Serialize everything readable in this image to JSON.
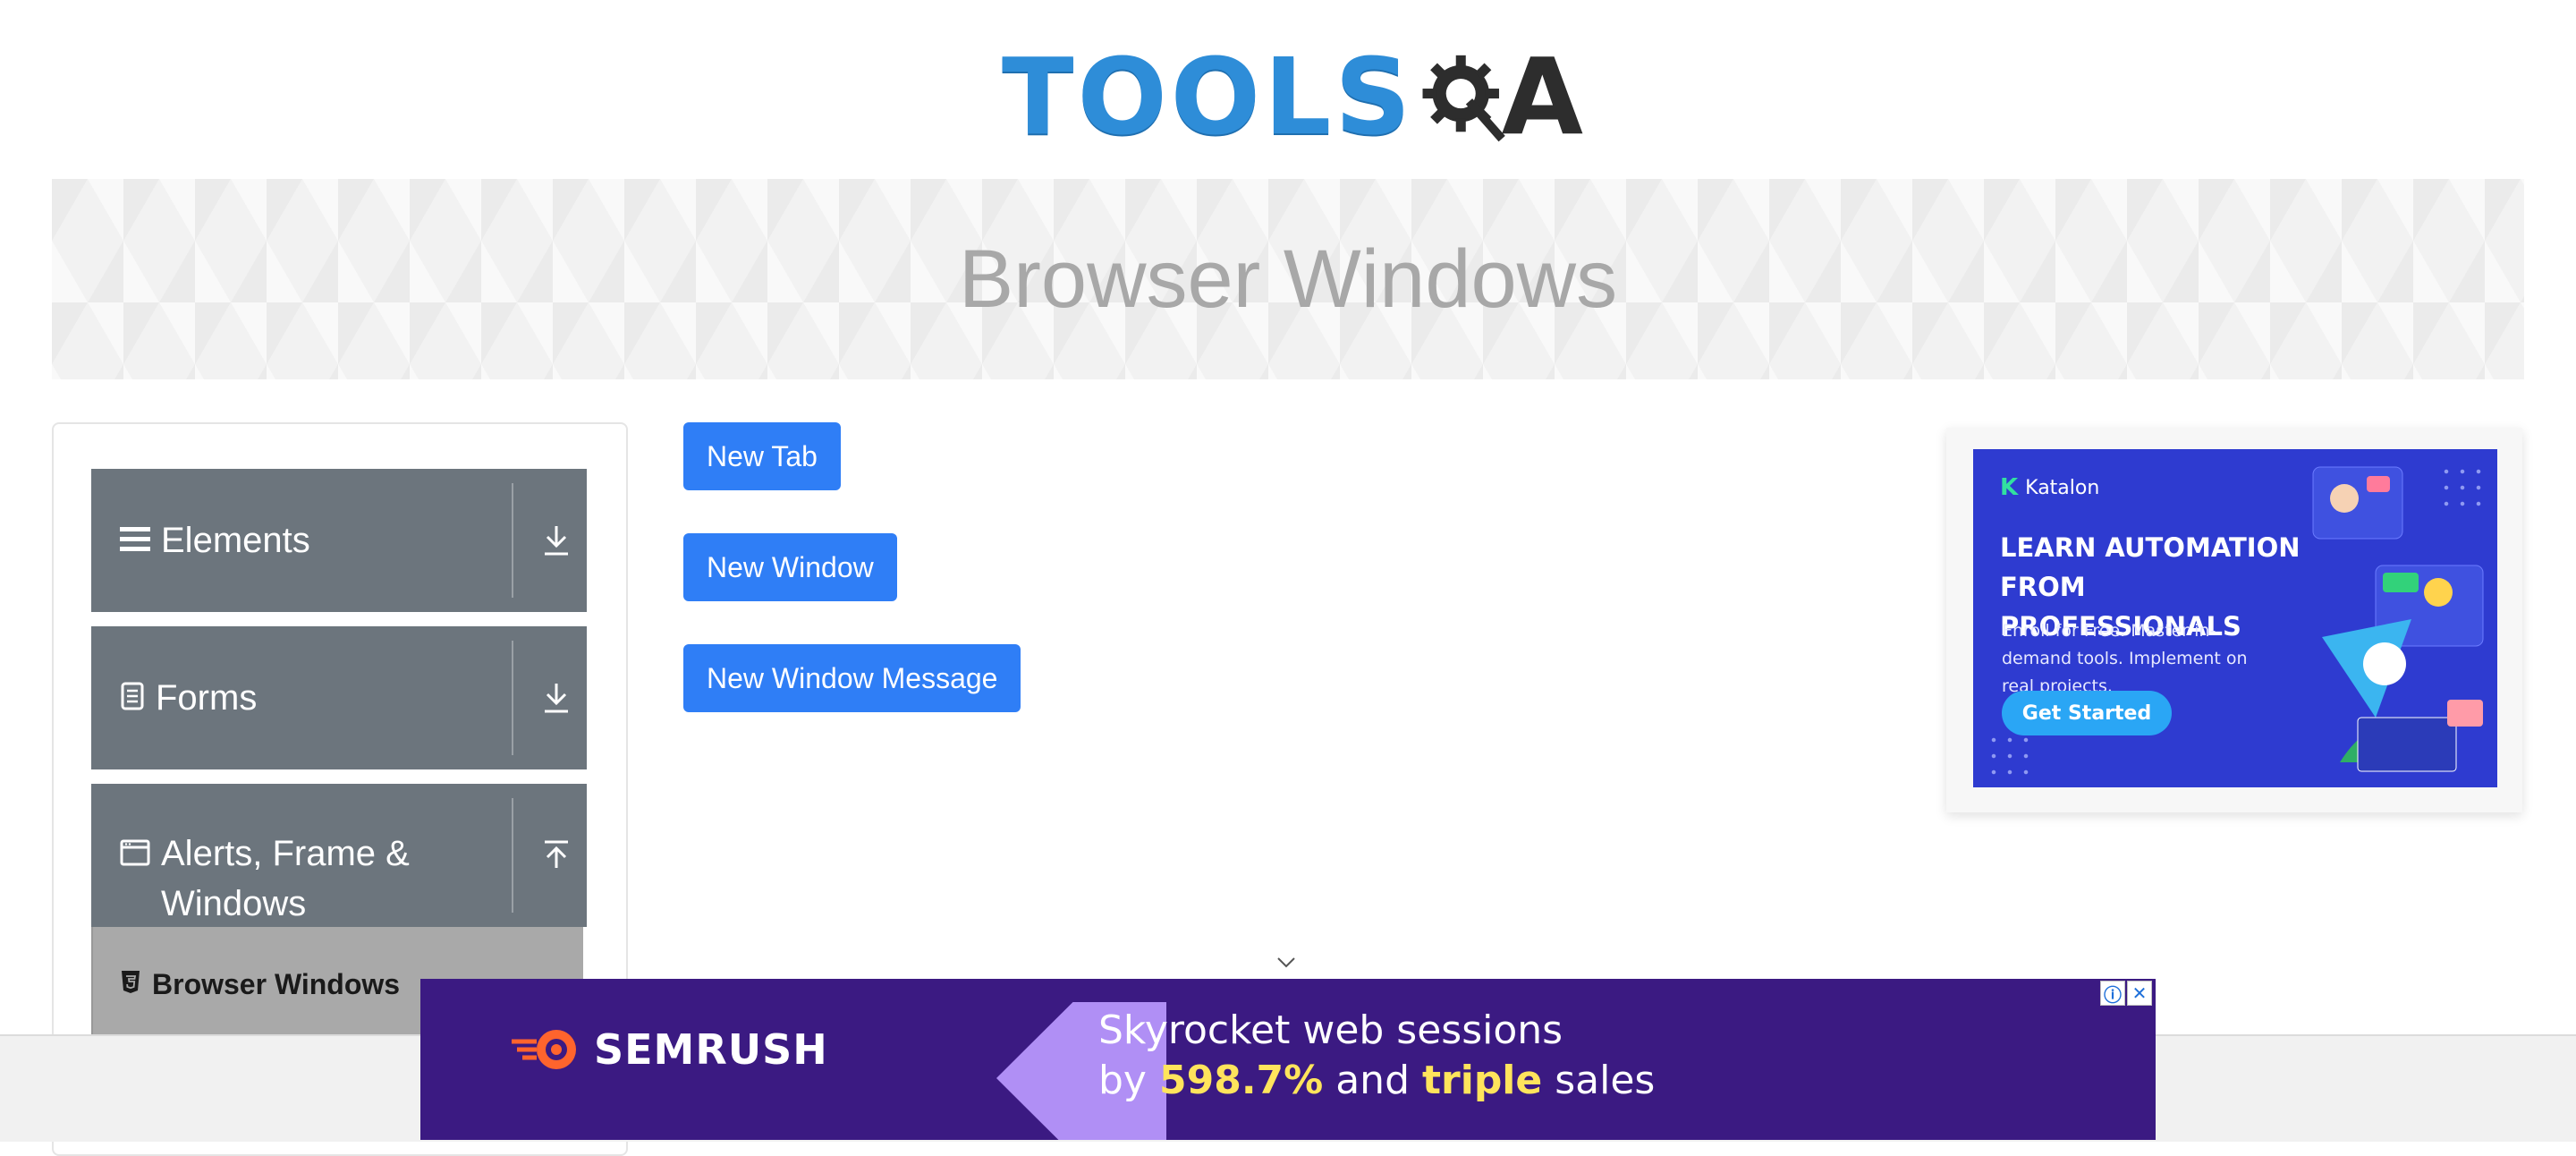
{
  "logo": {
    "text": "TOOLS",
    "suffix": "A",
    "alt": "TOOLSQA"
  },
  "page": {
    "title": "Browser Windows"
  },
  "sidebar": {
    "groups": [
      {
        "label": "Elements",
        "icon": "hamburger-icon",
        "toggle": "download-arrow-icon"
      },
      {
        "label": "Forms",
        "icon": "document-icon",
        "toggle": "download-arrow-icon"
      },
      {
        "label": "Alerts, Frame & Windows",
        "icon": "window-icon",
        "toggle": "upload-arrow-icon"
      }
    ],
    "active_item": {
      "label": "Browser Windows",
      "icon": "html5-icon"
    }
  },
  "buttons": {
    "new_tab": "New Tab",
    "new_window": "New Window",
    "new_window_message": "New Window Message"
  },
  "side_ad": {
    "brand": "Katalon",
    "headline": "LEARN AUTOMATION FROM PROFESSIONALS",
    "subtext": "Enroll for Free. Master in-demand tools. Implement on real projects.",
    "cta": "Get Started"
  },
  "bottom_ad": {
    "brand": "SEMRUSH",
    "line1": "Skyrocket web sessions",
    "line2_pre": "by ",
    "line2_hl1": "598.7%",
    "line2_mid": " and ",
    "line2_hl2": "triple",
    "line2_post": " sales"
  },
  "colors": {
    "primary_button": "#2f7ef6",
    "sidebar_header": "#6c757d",
    "active_item_bg": "#a9a9a9",
    "logo_blue": "#2e8dd8",
    "katalon_bg": "#2e3bd0",
    "semrush_bg": "#3b1a82"
  }
}
